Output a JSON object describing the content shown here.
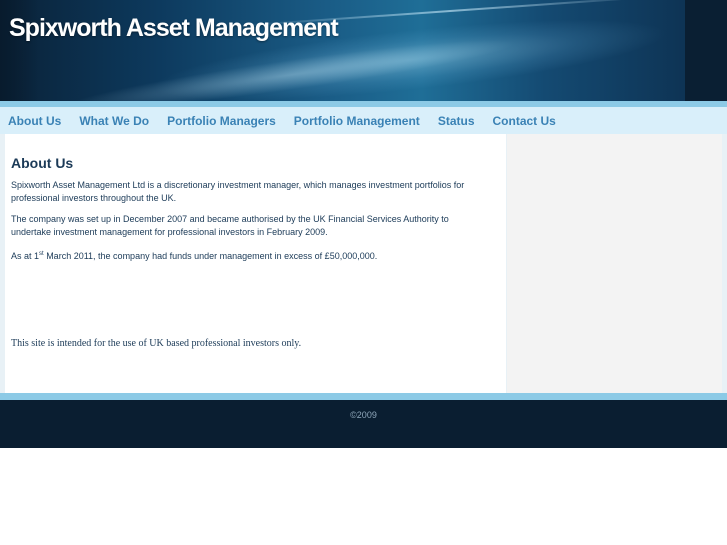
{
  "header": {
    "title": "Spixworth Asset Management"
  },
  "nav": {
    "items": [
      {
        "label": "About Us"
      },
      {
        "label": "What We Do"
      },
      {
        "label": "Portfolio Managers"
      },
      {
        "label": "Portfolio Management"
      },
      {
        "label": "Status"
      },
      {
        "label": "Contact Us"
      }
    ]
  },
  "main": {
    "heading": "About Us",
    "paragraph1": "Spixworth Asset Management Ltd is a discretionary investment manager, which manages investment portfolios for professional investors throughout the UK.",
    "paragraph2": "The company was set up in December 2007 and became authorised by the UK Financial Services Authority to undertake investment management for professional investors in February 2009.",
    "paragraph3_pre": "As at 1",
    "paragraph3_sup": "st",
    "paragraph3_post": " March 2011, the company had funds under management in excess of £50,000,000.",
    "disclaimer": "This site is intended for the use of UK based professional investors only."
  },
  "footer": {
    "copyright": "©2009"
  },
  "colors": {
    "nav_bg": "#d9effa",
    "nav_text": "#3a82b5",
    "accent_strip": "#8ccae6",
    "footer_bg": "#0a1e31",
    "heading_text": "#1b3a57"
  }
}
